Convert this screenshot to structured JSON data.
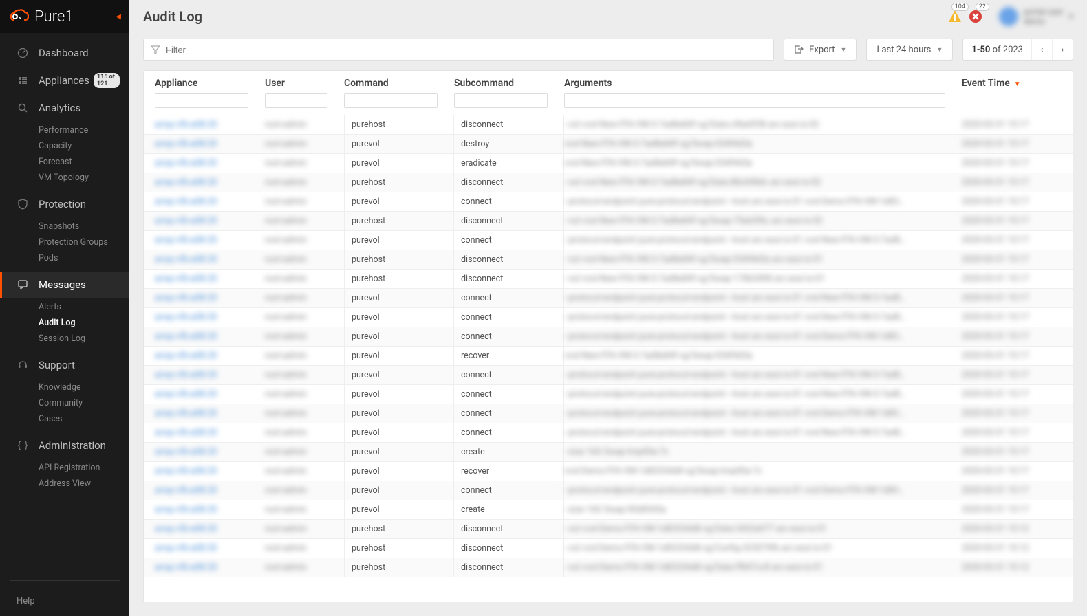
{
  "brand": "Pure1",
  "page_title": "Audit Log",
  "alerts": {
    "warning_count": "104",
    "error_count": "22"
  },
  "user": {
    "name": "portal user",
    "org": "demo"
  },
  "sidebar": {
    "items": [
      {
        "label": "Dashboard",
        "icon": "gauge"
      },
      {
        "label": "Appliances",
        "icon": "grid",
        "badge": "115 of 121"
      },
      {
        "label": "Analytics",
        "icon": "search",
        "children": [
          "Performance",
          "Capacity",
          "Forecast",
          "VM Topology"
        ]
      },
      {
        "label": "Protection",
        "icon": "shield",
        "children": [
          "Snapshots",
          "Protection Groups",
          "Pods"
        ]
      },
      {
        "label": "Messages",
        "icon": "chat",
        "active": true,
        "children": [
          "Alerts",
          "Audit Log",
          "Session Log"
        ],
        "active_child": 1
      },
      {
        "label": "Support",
        "icon": "headset",
        "children": [
          "Knowledge",
          "Community",
          "Cases"
        ]
      },
      {
        "label": "Administration",
        "icon": "braces",
        "children": [
          "API Registration",
          "Address View"
        ]
      }
    ],
    "help": "Help"
  },
  "toolbar": {
    "filter_placeholder": "Filter",
    "export_label": "Export",
    "range_label": "Last 24 hours",
    "pager_range": "1-50",
    "pager_total": "of 2023"
  },
  "columns": {
    "appliance": "Appliance",
    "user": "User",
    "command": "Command",
    "subcommand": "Subcommand",
    "arguments": "Arguments",
    "event_time": "Event Time"
  },
  "rows": [
    {
      "appliance": "array-vfb-a08-20",
      "user": "root-admin",
      "command": "purehost",
      "subcommand": "disconnect",
      "arguments": "--vol vvol-New-FFA-VM-3-7ad8e84f-vg/Data-c9be0f38 arc-esxi-is-02",
      "time": "2020-03-31 15:17"
    },
    {
      "appliance": "array-vfb-a08-20",
      "user": "root-admin",
      "command": "purevol",
      "subcommand": "destroy",
      "arguments": "vvol-New-FFA-VM-3-7ad8e84f-vg/Swap-034f4d3a",
      "time": "2020-03-31 15:17"
    },
    {
      "appliance": "array-vfb-a08-20",
      "user": "root-admin",
      "command": "purevol",
      "subcommand": "eradicate",
      "arguments": "vvol-New-FFA-VM-3-7ad8e84f-vg/Swap-034f4d3a",
      "time": "2020-03-31 15:17"
    },
    {
      "appliance": "array-vfb-a08-20",
      "user": "root-admin",
      "command": "purehost",
      "subcommand": "disconnect",
      "arguments": "--vol vvol-New-FFA-VM-3-7ad8e84f-vg/Data-88cb98dc arc-esxi-is-02",
      "time": "2020-03-31 15:17"
    },
    {
      "appliance": "array-vfb-a08-20",
      "user": "root-admin",
      "command": "purevol",
      "subcommand": "connect",
      "arguments": "--protocol-endpoint pure-protocol-endpoint --host arc-esxi-is-01 vvol-Demo-FFA-VM-1d83…",
      "time": "2020-03-31 15:17"
    },
    {
      "appliance": "array-vfb-a08-20",
      "user": "root-admin",
      "command": "purehost",
      "subcommand": "disconnect",
      "arguments": "--vol vvol-New-FFA-VM-3-7ad8e84f-vg/Swap-75eb5f6c arc-esxi-is-02",
      "time": "2020-03-31 15:17"
    },
    {
      "appliance": "array-vfb-a08-20",
      "user": "root-admin",
      "command": "purevol",
      "subcommand": "connect",
      "arguments": "--protocol-endpoint pure-protocol-endpoint --host arc-esxi-is-01 vvol-New-FFA-VM-3-7ad8…",
      "time": "2020-03-31 15:17"
    },
    {
      "appliance": "array-vfb-a08-20",
      "user": "root-admin",
      "command": "purehost",
      "subcommand": "disconnect",
      "arguments": "--vol vvol-New-FFA-VM-3-7ad8e84f-vg/Swap-034f4d3a arc-esxi-is-01",
      "time": "2020-03-31 15:17"
    },
    {
      "appliance": "array-vfb-a08-20",
      "user": "root-admin",
      "command": "purehost",
      "subcommand": "disconnect",
      "arguments": "--vol vvol-New-FFA-VM-3-7ad8e84f-vg/Swap-178b3498 arc-esxi-is-01",
      "time": "2020-03-31 15:17"
    },
    {
      "appliance": "array-vfb-a08-20",
      "user": "root-admin",
      "command": "purevol",
      "subcommand": "connect",
      "arguments": "--protocol-endpoint pure-protocol-endpoint --host arc-esxi-is-01 vvol-New-FFA-VM-3-7ad8…",
      "time": "2020-03-31 15:17"
    },
    {
      "appliance": "array-vfb-a08-20",
      "user": "root-admin",
      "command": "purevol",
      "subcommand": "connect",
      "arguments": "--protocol-endpoint pure-protocol-endpoint --host arc-esxi-is-01 vvol-New-FFA-VM-3-7ad8…",
      "time": "2020-03-31 15:17"
    },
    {
      "appliance": "array-vfb-a08-20",
      "user": "root-admin",
      "command": "purevol",
      "subcommand": "connect",
      "arguments": "--protocol-endpoint pure-protocol-endpoint --host arc-esxi-is-01 vvol-Demo-FFA-VM-1d83…",
      "time": "2020-03-31 15:17"
    },
    {
      "appliance": "array-vfb-a08-20",
      "user": "root-admin",
      "command": "purevol",
      "subcommand": "recover",
      "arguments": "vvol-New-FFA-VM-3-7ad8e84f-vg/Swap-034f4d3a",
      "time": "2020-03-31 15:17"
    },
    {
      "appliance": "array-vfb-a08-20",
      "user": "root-admin",
      "command": "purevol",
      "subcommand": "connect",
      "arguments": "--protocol-endpoint pure-protocol-endpoint --host arc-esxi-is-01 vvol-New-FFA-VM-3-7ad8…",
      "time": "2020-03-31 15:17"
    },
    {
      "appliance": "array-vfb-a08-20",
      "user": "root-admin",
      "command": "purevol",
      "subcommand": "connect",
      "arguments": "--protocol-endpoint pure-protocol-endpoint --host arc-esxi-is-01 vvol-New-FFA-VM-3-7ad8…",
      "time": "2020-03-31 15:17"
    },
    {
      "appliance": "array-vfb-a08-20",
      "user": "root-admin",
      "command": "purevol",
      "subcommand": "connect",
      "arguments": "--protocol-endpoint pure-protocol-endpoint --host arc-esxi-is-01 vvol-Demo-FFA-VM-1d83…",
      "time": "2020-03-31 15:17"
    },
    {
      "appliance": "array-vfb-a08-20",
      "user": "root-admin",
      "command": "purevol",
      "subcommand": "connect",
      "arguments": "--protocol-endpoint pure-protocol-endpoint --host arc-esxi-is-01 vvol-New-FFA-VM-3-7ad8…",
      "time": "2020-03-31 15:17"
    },
    {
      "appliance": "array-vfb-a08-20",
      "user": "root-admin",
      "command": "purevol",
      "subcommand": "create",
      "arguments": "--size 16G Swap-tmp00a-7c",
      "time": "2020-03-31 15:17"
    },
    {
      "appliance": "array-vfb-a08-20",
      "user": "root-admin",
      "command": "purevol",
      "subcommand": "recover",
      "arguments": "vvol-Demo-FFA-VM-1d83334d8-vg/Swap-tmp00a-7c",
      "time": "2020-03-31 15:17"
    },
    {
      "appliance": "array-vfb-a08-20",
      "user": "root-admin",
      "command": "purevol",
      "subcommand": "connect",
      "arguments": "--protocol-endpoint pure-protocol-endpoint --host arc-esxi-is-01 vvol-Demo-FFA-VM-1d83…",
      "time": "2020-03-31 15:17"
    },
    {
      "appliance": "array-vfb-a08-20",
      "user": "root-admin",
      "command": "purevol",
      "subcommand": "create",
      "arguments": "--size 16G Swap-90d8343a",
      "time": "2020-03-31 15:17"
    },
    {
      "appliance": "array-vfb-a08-20",
      "user": "root-admin",
      "command": "purehost",
      "subcommand": "disconnect",
      "arguments": "--vol vvol-Demo-FFA-VM-1d83334d8-vg/Data-3432e077 arc-esxi-is-01",
      "time": "2020-03-31 15:12"
    },
    {
      "appliance": "array-vfb-a08-20",
      "user": "root-admin",
      "command": "purehost",
      "subcommand": "disconnect",
      "arguments": "--vol vvol-Demo-FFA-VM-1d83334d8-vg/Config-323079fb arc-esxi-is-01",
      "time": "2020-03-31 15:12"
    },
    {
      "appliance": "array-vfb-a08-20",
      "user": "root-admin",
      "command": "purehost",
      "subcommand": "disconnect",
      "arguments": "--vol vvol-Demo-FFA-VM-1d83334d8-vg/Data-ff847cc8 arc-esxi-is-01",
      "time": "2020-03-31 15:12"
    }
  ]
}
